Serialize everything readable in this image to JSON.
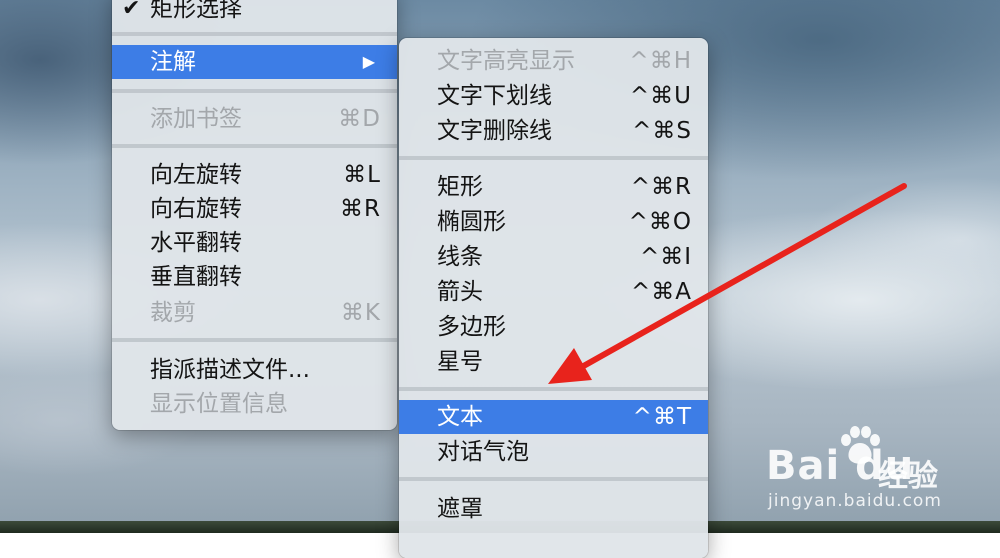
{
  "left_menu": {
    "items": [
      {
        "label": "矩形选择",
        "shortcut": "",
        "checked": true,
        "disabled": false
      },
      {
        "label": "注解",
        "shortcut": "",
        "submenu_arrow": "▶",
        "selected": true
      },
      {
        "label": "添加书签",
        "shortcut": "⌘D",
        "disabled": true
      },
      {
        "label": "向左旋转",
        "shortcut": "⌘L"
      },
      {
        "label": "向右旋转",
        "shortcut": "⌘R"
      },
      {
        "label": "水平翻转",
        "shortcut": ""
      },
      {
        "label": "垂直翻转",
        "shortcut": ""
      },
      {
        "label": "裁剪",
        "shortcut": "⌘K",
        "disabled": true
      },
      {
        "label": "指派描述文件...",
        "shortcut": ""
      },
      {
        "label": "显示位置信息",
        "shortcut": "",
        "disabled": true
      }
    ],
    "check_glyph": "✔"
  },
  "annotate_submenu": {
    "items": [
      {
        "label": "文字高亮显示",
        "shortcut": "^⌘H",
        "disabled": true
      },
      {
        "label": "文字下划线",
        "shortcut": "^⌘U"
      },
      {
        "label": "文字删除线",
        "shortcut": "^⌘S"
      },
      {
        "label": "矩形",
        "shortcut": "^⌘R"
      },
      {
        "label": "椭圆形",
        "shortcut": "^⌘O"
      },
      {
        "label": "线条",
        "shortcut": "^⌘I"
      },
      {
        "label": "箭头",
        "shortcut": "^⌘A"
      },
      {
        "label": "多边形",
        "shortcut": ""
      },
      {
        "label": "星号",
        "shortcut": ""
      },
      {
        "label": "文本",
        "shortcut": "^⌘T",
        "selected": true
      },
      {
        "label": "对话气泡",
        "shortcut": ""
      },
      {
        "label": "遮罩",
        "shortcut": ""
      }
    ]
  },
  "annotation": {
    "arrow_color": "#e8231c"
  },
  "watermark": {
    "logo": "Bai du",
    "suffix": "经验",
    "url": "jingyan.baidu.com"
  },
  "colors": {
    "selection": "#3d7de6",
    "menu_bg": "#e0e5e9"
  }
}
